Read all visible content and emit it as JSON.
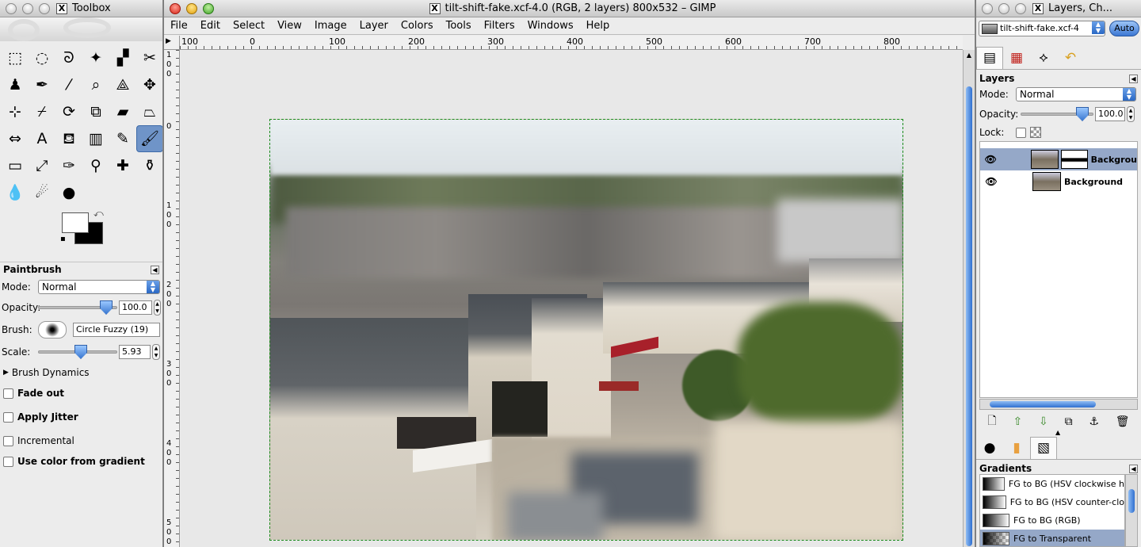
{
  "toolbox": {
    "title": "Toolbox",
    "tools": [
      {
        "name": "rect-select-icon",
        "glyph": "⬚"
      },
      {
        "name": "ellipse-select-icon",
        "glyph": "◌"
      },
      {
        "name": "free-select-icon",
        "glyph": "ᘐ"
      },
      {
        "name": "fuzzy-select-icon",
        "glyph": "✦"
      },
      {
        "name": "select-by-color-icon",
        "glyph": "▞"
      },
      {
        "name": "scissors-icon",
        "glyph": "✂"
      },
      {
        "name": "foreground-select-icon",
        "glyph": "♟"
      },
      {
        "name": "paths-icon",
        "glyph": "✒"
      },
      {
        "name": "color-picker-icon",
        "glyph": "⁄"
      },
      {
        "name": "zoom-icon",
        "glyph": "⌕"
      },
      {
        "name": "measure-icon",
        "glyph": "⟁"
      },
      {
        "name": "move-icon",
        "glyph": "✥"
      },
      {
        "name": "align-icon",
        "glyph": "⊹"
      },
      {
        "name": "crop-icon",
        "glyph": "⌿"
      },
      {
        "name": "rotate-icon",
        "glyph": "⟳"
      },
      {
        "name": "scale-icon",
        "glyph": "⧉"
      },
      {
        "name": "shear-icon",
        "glyph": "▰"
      },
      {
        "name": "perspective-icon",
        "glyph": "⏢"
      },
      {
        "name": "flip-icon",
        "glyph": "⇔"
      },
      {
        "name": "text-icon",
        "glyph": "A"
      },
      {
        "name": "bucket-fill-icon",
        "glyph": "⛾"
      },
      {
        "name": "blend-icon",
        "glyph": "▥"
      },
      {
        "name": "pencil-icon",
        "glyph": "✎"
      },
      {
        "name": "paintbrush-icon",
        "glyph": "🖌"
      },
      {
        "name": "eraser-icon",
        "glyph": "▭"
      },
      {
        "name": "airbrush-icon",
        "glyph": "⤢"
      },
      {
        "name": "ink-icon",
        "glyph": "✑"
      },
      {
        "name": "clone-icon",
        "glyph": "⚲"
      },
      {
        "name": "heal-icon",
        "glyph": "✚"
      },
      {
        "name": "perspective-clone-icon",
        "glyph": "⚱"
      },
      {
        "name": "blur-icon",
        "glyph": "💧"
      },
      {
        "name": "smudge-icon",
        "glyph": "☄"
      },
      {
        "name": "dodge-burn-icon",
        "glyph": "●"
      }
    ],
    "colors": {
      "fg": "#ffffff",
      "bg": "#000000"
    }
  },
  "tool_options": {
    "title": "Paintbrush",
    "mode_label": "Mode:",
    "mode_value": "Normal",
    "opacity_label": "Opacity:",
    "opacity_value": "100.0",
    "opacity_fraction": 1.0,
    "brush_label": "Brush:",
    "brush_value": "Circle Fuzzy (19)",
    "scale_label": "Scale:",
    "scale_value": "5.93",
    "scale_fraction": 0.59,
    "brush_dynamics": "Brush Dynamics",
    "fade_out": "Fade out",
    "apply_jitter": "Apply Jitter",
    "incremental": "Incremental",
    "use_gradient": "Use color from gradient"
  },
  "image_window": {
    "title": "tilt-shift-fake.xcf-4.0 (RGB, 2 layers) 800x532 – GIMP",
    "menus": [
      "File",
      "Edit",
      "Select",
      "View",
      "Image",
      "Layer",
      "Colors",
      "Tools",
      "Filters",
      "Windows",
      "Help"
    ],
    "ruler_h": [
      "100",
      "0",
      "100",
      "200",
      "300",
      "400",
      "500",
      "600",
      "700",
      "800"
    ],
    "ruler_v": [
      [
        "1",
        "0",
        "0"
      ],
      [
        "0"
      ],
      [
        "1",
        "0",
        "0"
      ],
      [
        "2",
        "0",
        "0"
      ],
      [
        "3",
        "0",
        "0"
      ],
      [
        "4",
        "0",
        "0"
      ],
      [
        "5",
        "0",
        "0"
      ]
    ]
  },
  "dock": {
    "title": "Layers, Ch...",
    "image_select": "tilt-shift-fake.xcf-4",
    "auto": "Auto",
    "layers_title": "Layers",
    "mode_label": "Mode:",
    "mode_value": "Normal",
    "opacity_label": "Opacity:",
    "opacity_value": "100.0",
    "opacity_fraction": 1.0,
    "lock_label": "Lock:",
    "layers": [
      {
        "name": "Backgrou",
        "selected": true,
        "mask": true
      },
      {
        "name": "Background",
        "selected": false,
        "mask": false
      }
    ],
    "gradients_title": "Gradients",
    "gradients": [
      {
        "name": "FG to BG (HSV clockwise h",
        "selected": false,
        "transparent": false
      },
      {
        "name": "FG to BG (HSV counter-clo",
        "selected": false,
        "transparent": false
      },
      {
        "name": "FG to BG (RGB)",
        "selected": false,
        "transparent": false
      },
      {
        "name": "FG to Transparent",
        "selected": true,
        "transparent": true
      }
    ]
  }
}
